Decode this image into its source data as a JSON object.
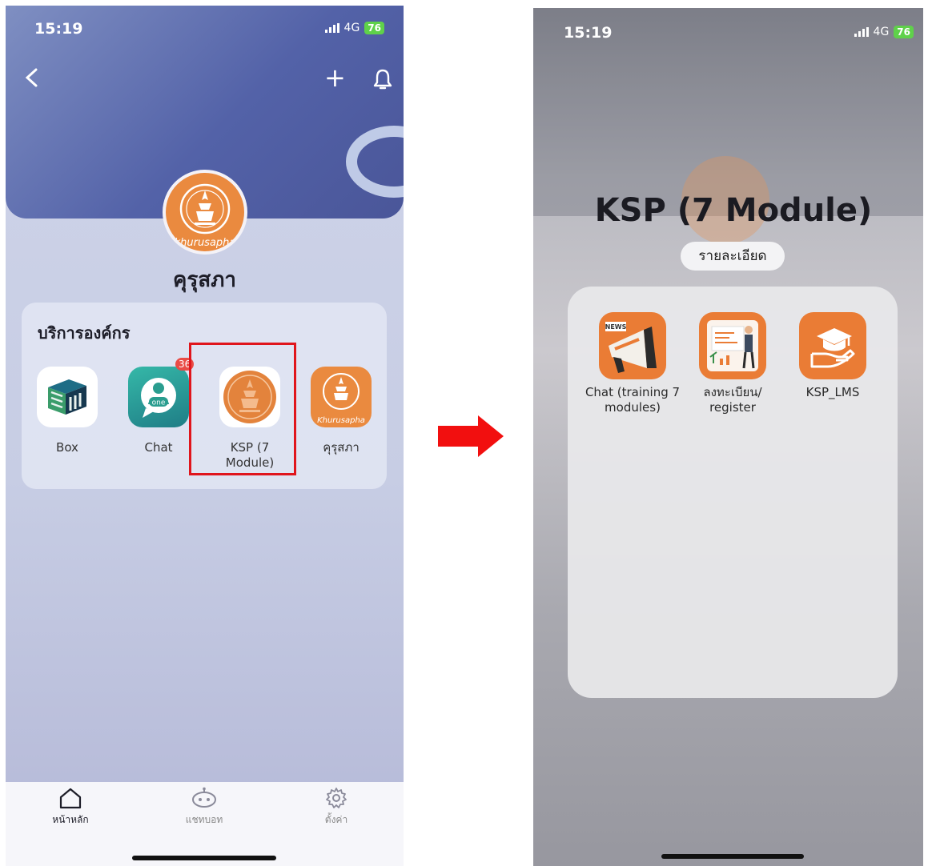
{
  "left_screen": {
    "status_bar": {
      "time": "15:19",
      "network": "4G",
      "battery": "76"
    },
    "header": {
      "back_icon": "chevron-left-icon",
      "add_icon": "plus-icon",
      "bell_icon": "bell-icon"
    },
    "org": {
      "avatar_text": "khurusapha",
      "name": "คุรุสภา"
    },
    "services": {
      "title": "บริการองค์กร",
      "items": [
        {
          "label": "Box",
          "icon": "box-icon"
        },
        {
          "label": "Chat",
          "icon": "chat-icon",
          "badge": "36"
        },
        {
          "label": "KSP (7 Module)",
          "icon": "ksp-seal-icon"
        },
        {
          "label": "คุรุสภา",
          "icon": "khurusapha-icon",
          "icon_text": "Khurusapha"
        }
      ]
    },
    "tabbar": [
      {
        "label": "หน้าหลัก",
        "icon": "home-icon"
      },
      {
        "label": "แชทบอท",
        "icon": "chatbot-icon"
      },
      {
        "label": "ตั้งค่า",
        "icon": "settings-gear-icon"
      }
    ],
    "highlight_color": "#e0151c"
  },
  "arrow": {
    "color": "#f20f0f"
  },
  "right_screen": {
    "status_bar": {
      "time": "15:19",
      "network": "4G",
      "battery": "76"
    },
    "folder_title": "KSP (7 Module)",
    "detail_button": "รายละเอียด",
    "apps": [
      {
        "label": "Chat (training 7 modules)",
        "icon": "news-megaphone-icon",
        "icon_text": "NEWS"
      },
      {
        "label": "ลงทะเบียน/ register",
        "icon": "register-presentation-icon"
      },
      {
        "label": "KSP_LMS",
        "icon": "graduation-cap-hand-icon"
      }
    ]
  },
  "colors": {
    "accent_orange": "#ea8a3f",
    "hero_blue": "#5362a8",
    "badge_red": "#e94c46"
  }
}
